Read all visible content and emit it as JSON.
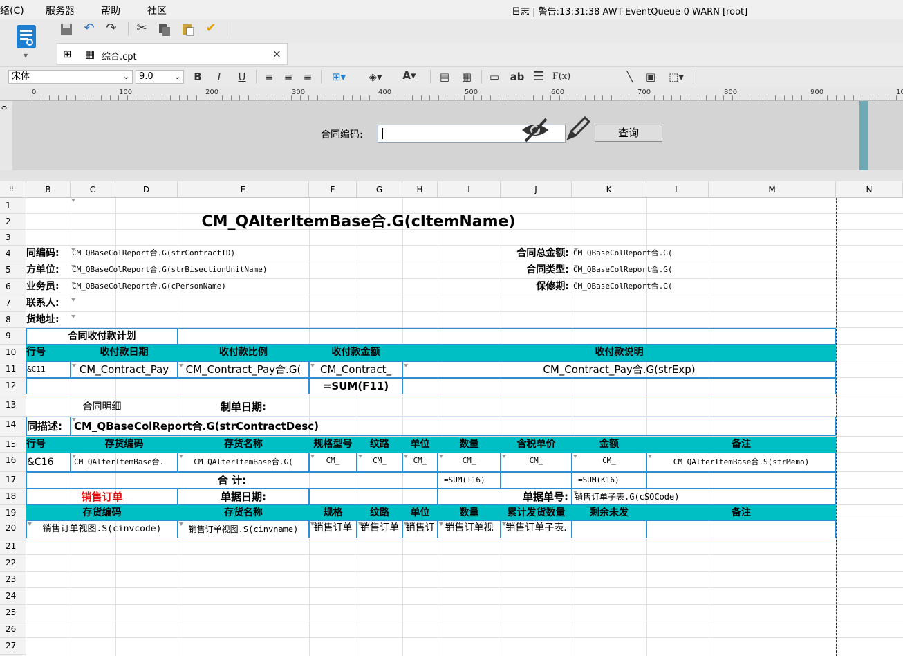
{
  "menubar": {
    "items": [
      "络(C)",
      "服务器",
      "帮助",
      "社区"
    ],
    "log": "日志  |  警告:13:31:38 AWT-EventQueue-0 WARN [root]"
  },
  "tab": {
    "title": "综合.cpt"
  },
  "format": {
    "font": "宋体",
    "size": "9.0",
    "bold": "B",
    "italic": "I",
    "underline": "U",
    "ab": "ab",
    "fx": "F(x)"
  },
  "ruler": {
    "labels": [
      "0",
      "100",
      "200",
      "300",
      "400",
      "500",
      "600",
      "700",
      "800",
      "900",
      "10"
    ]
  },
  "param": {
    "label": "合同编码:",
    "query": "查询",
    "value": ""
  },
  "columns": [
    "B",
    "C",
    "D",
    "E",
    "F",
    "G",
    "H",
    "I",
    "J",
    "K",
    "L",
    "M",
    "N"
  ],
  "rows": [
    "1",
    "2",
    "3",
    "4",
    "5",
    "6",
    "7",
    "8",
    "9",
    "10",
    "11",
    "12",
    "13",
    "14",
    "15",
    "16",
    "17",
    "18",
    "19",
    "20",
    "21",
    "22",
    "23",
    "24",
    "25",
    "26",
    "27"
  ],
  "cells": {
    "title": "CM_QAlterItemBase合.G(cItemName)",
    "r4_b": "同编码:",
    "r4_c": "CM_QBaseColReport合.G(strContractID)",
    "r4_j": "合同总金额:",
    "r4_k": "CM_QBaseColReport合.G(",
    "r5_b": "方单位:",
    "r5_c": "CM_QBaseColReport合.G(strBisectionUnitName)",
    "r5_j": "合同类型:",
    "r5_k": "CM_QBaseColReport合.G(",
    "r6_b": "业务员:",
    "r6_c": "CM_QBaseColReport合.G(cPersonName)",
    "r6_j": "保修期:",
    "r6_k": "CM_QBaseColReport合.G(",
    "r7_b": "联系人:",
    "r8_b": "货地址:",
    "r9": "合同收付款计划",
    "r10_b": "行号",
    "r10_c": "收付款日期",
    "r10_e": "收付款比例",
    "r10_f": "收付款金额",
    "r10_h": "收付款说明",
    "r11_b": "&C11",
    "r11_c": "CM_Contract_Pay",
    "r11_e": "CM_Contract_Pay合.G(",
    "r11_f": "CM_Contract_",
    "r11_h": "CM_Contract_Pay合.G(strExp)",
    "r12_f": "=SUM(F11)",
    "r13_b": "合同明细",
    "r13_e": "制单日期:",
    "r14_b": "同描述:",
    "r14_c": "CM_QBaseColReport合.G(strContractDesc)",
    "r15": [
      "行号",
      "存货编码",
      "存货名称",
      "规格型号",
      "纹路",
      "单位",
      "数量",
      "含税单价",
      "金额",
      "备注"
    ],
    "r16_b": "&C16",
    "r16_c": "CM_QAlterItemBase合.",
    "r16_e": "CM_QAlterItemBase合.G(",
    "r16_f": "CM_",
    "r16_g": "CM_",
    "r16_h": "CM_",
    "r16_i": "CM_",
    "r16_j": "CM_",
    "r16_k": "CM_",
    "r16_l": "CM_QAlterItemBase合.S(strMemo)",
    "r17_total": "合 计:",
    "r17_i": "=SUM(I16)",
    "r17_k": "=SUM(K16)",
    "r18_b": "销售订单",
    "r18_e": "单据日期:",
    "r18_j": "单据单号:",
    "r18_k": "销售订单子表.G(cSOCode)",
    "r19": [
      "存货编码",
      "存货名称",
      "规格",
      "纹路",
      "单位",
      "数量",
      "累计发货数量",
      "剩余未发",
      "备注"
    ],
    "r20_b": "销售订单视图.S(cinvcode)",
    "r20_e": "销售订单视图.S(cinvname)",
    "r20_f": "销售订单",
    "r20_g": "销售订单",
    "r20_h": "销售订",
    "r20_i": "销售订单视",
    "r20_j": "销售订单子表."
  },
  "colors": {
    "teal": "#00bfc4",
    "red": "#e01010",
    "blue": "#2c8fd6"
  }
}
